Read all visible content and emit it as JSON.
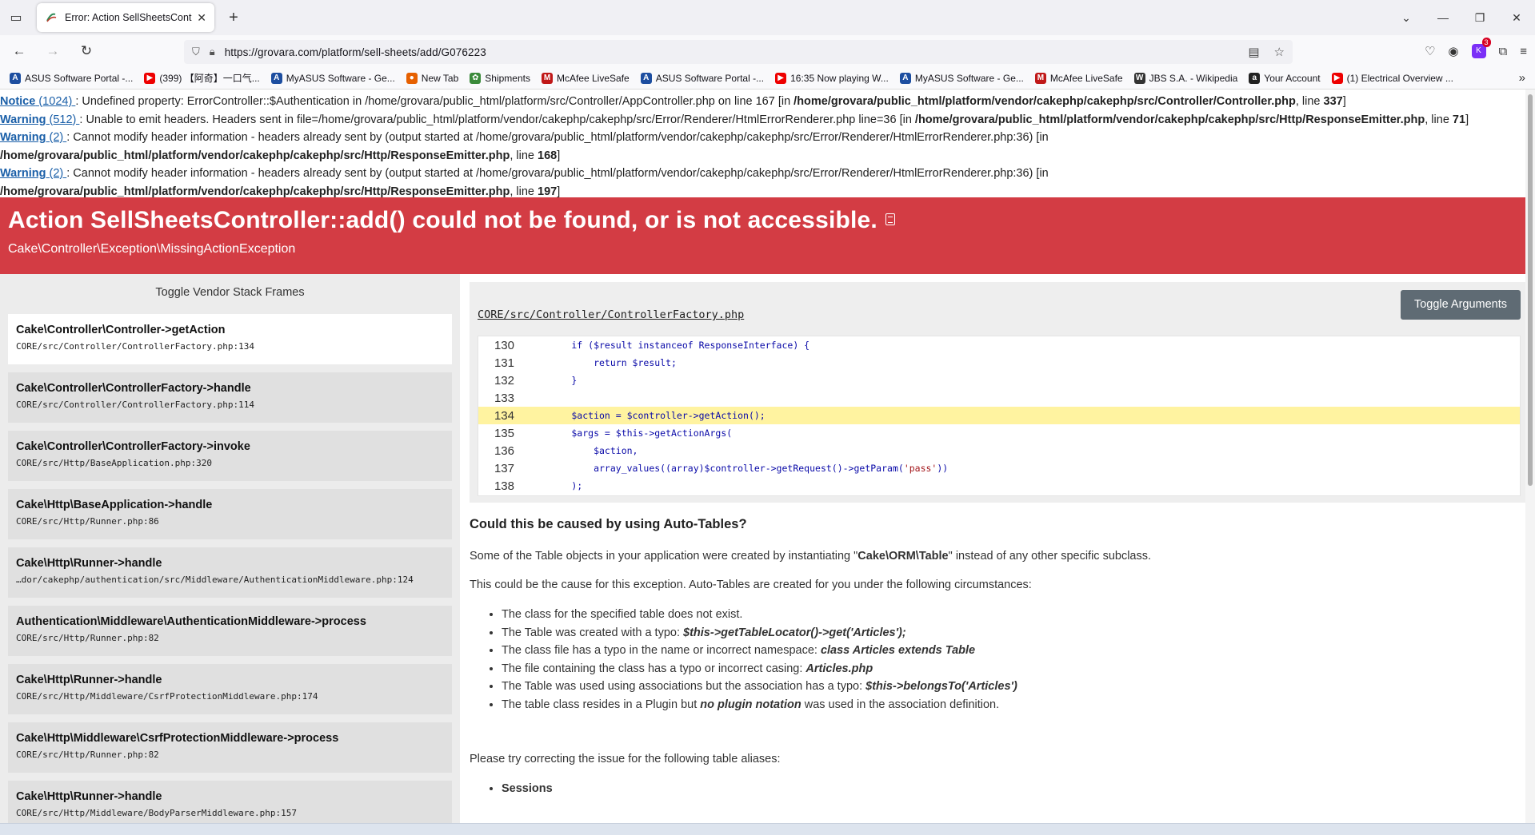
{
  "browser": {
    "tab_title": "Error: Action SellSheetsControll",
    "url": "https://grovara.com/platform/sell-sheets/add/G076223",
    "extension_count": "3",
    "bookmarks": [
      {
        "label": "ASUS Software Portal -...",
        "icon": "asus-icon",
        "color": "#1d4ea0"
      },
      {
        "label": "(399) 【阿奇】一口气...",
        "icon": "youtube-icon",
        "color": "#e00"
      },
      {
        "label": "MyASUS Software - Ge...",
        "icon": "asus-icon",
        "color": "#1d4ea0"
      },
      {
        "label": "New Tab",
        "icon": "firefox-icon",
        "color": "#e66000"
      },
      {
        "label": "Shipments",
        "icon": "gear-icon",
        "color": "#3a8a3a"
      },
      {
        "label": "McAfee LiveSafe",
        "icon": "mcafee-icon",
        "color": "#c01818"
      },
      {
        "label": "ASUS Software Portal -...",
        "icon": "asus-icon",
        "color": "#1d4ea0"
      },
      {
        "label": "16:35  Now playing  W...",
        "icon": "youtube-icon",
        "color": "#e00"
      },
      {
        "label": "MyASUS Software - Ge...",
        "icon": "asus-icon",
        "color": "#1d4ea0"
      },
      {
        "label": "McAfee LiveSafe",
        "icon": "mcafee-icon",
        "color": "#c01818"
      },
      {
        "label": "JBS S.A. - Wikipedia",
        "icon": "wikipedia-icon",
        "color": "#333"
      },
      {
        "label": "Your Account",
        "icon": "amazon-icon",
        "color": "#222"
      },
      {
        "label": "(1) Electrical Overview ...",
        "icon": "youtube-icon",
        "color": "#e00"
      }
    ]
  },
  "notices": [
    {
      "type": "Notice",
      "code": "(1024)",
      "text": ": Undefined property: ErrorController::$Authentication in /home/grovara/public_html/platform/src/Controller/AppController.php on line 167 [in ",
      "path": "/home/grovara/public_html/platform/vendor/cakephp/cakephp/src/Controller/Controller.php",
      "line_label": ", line ",
      "line": "337",
      "tail": "]"
    },
    {
      "type": "Warning",
      "code": "(512)",
      "text": ": Unable to emit headers. Headers sent in file=/home/grovara/public_html/platform/vendor/cakephp/cakephp/src/Error/Renderer/HtmlErrorRenderer.php line=36 [in ",
      "path": "/home/grovara/public_html/platform/vendor/cakephp/cakephp/src/Http/ResponseEmitter.php",
      "line_label": ", line ",
      "line": "71",
      "tail": "]"
    },
    {
      "type": "Warning",
      "code": "(2)",
      "text": ": Cannot modify header information - headers already sent by (output started at /home/grovara/public_html/platform/vendor/cakephp/cakephp/src/Error/Renderer/HtmlErrorRenderer.php:36) [in ",
      "path": "/home/grovara/public_html/platform/vendor/cakephp/cakephp/src/Http/ResponseEmitter.php",
      "line_label": ", line ",
      "line": "168",
      "tail": "]"
    },
    {
      "type": "Warning",
      "code": "(2)",
      "text": ": Cannot modify header information - headers already sent by (output started at /home/grovara/public_html/platform/vendor/cakephp/cakephp/src/Error/Renderer/HtmlErrorRenderer.php:36) [in ",
      "path": "/home/grovara/public_html/platform/vendor/cakephp/cakephp/src/Http/ResponseEmitter.php",
      "line_label": ", line ",
      "line": "197",
      "tail": "]"
    }
  ],
  "error": {
    "title": "Action SellSheetsController::add() could not be found, or is not accessible.",
    "exception": "Cake\\Controller\\Exception\\MissingActionException",
    "header_color": "#d33c44"
  },
  "stack": {
    "toggle_label": "Toggle Vendor Stack Frames",
    "frames": [
      {
        "name": "Cake\\Controller\\Controller->getAction",
        "location": "CORE/src/Controller/ControllerFactory.php:134",
        "active": true
      },
      {
        "name": "Cake\\Controller\\ControllerFactory->handle",
        "location": "CORE/src/Controller/ControllerFactory.php:114",
        "active": false
      },
      {
        "name": "Cake\\Controller\\ControllerFactory->invoke",
        "location": "CORE/src/Http/BaseApplication.php:320",
        "active": false
      },
      {
        "name": "Cake\\Http\\BaseApplication->handle",
        "location": "CORE/src/Http/Runner.php:86",
        "active": false
      },
      {
        "name": "Cake\\Http\\Runner->handle",
        "location": "…dor/cakephp/authentication/src/Middleware/AuthenticationMiddleware.php:124",
        "active": false
      },
      {
        "name": "Authentication\\Middleware\\AuthenticationMiddleware->process",
        "location": "CORE/src/Http/Runner.php:82",
        "active": false
      },
      {
        "name": "Cake\\Http\\Runner->handle",
        "location": "CORE/src/Http/Middleware/CsrfProtectionMiddleware.php:174",
        "active": false
      },
      {
        "name": "Cake\\Http\\Middleware\\CsrfProtectionMiddleware->process",
        "location": "CORE/src/Http/Runner.php:82",
        "active": false
      },
      {
        "name": "Cake\\Http\\Runner->handle",
        "location": "CORE/src/Http/Middleware/BodyParserMiddleware.php:157",
        "active": false
      }
    ]
  },
  "code": {
    "file": "CORE/src/Controller/ControllerFactory.php",
    "toggle_args_label": "Toggle Arguments",
    "highlight_line": "134",
    "lines": [
      {
        "n": "130",
        "text": "        if ($result instanceof ResponseInterface) {"
      },
      {
        "n": "131",
        "text": "            return $result;"
      },
      {
        "n": "132",
        "text": "        }"
      },
      {
        "n": "133",
        "text": ""
      },
      {
        "n": "134",
        "text": "        $action = $controller->getAction();"
      },
      {
        "n": "135",
        "text": "        $args = $this->getActionArgs("
      },
      {
        "n": "136",
        "text": "            $action,"
      },
      {
        "n": "137",
        "text": "            array_values((array)$controller->getRequest()->getParam(",
        "str": "'pass'",
        "after": "))"
      },
      {
        "n": "138",
        "text": "        );"
      }
    ]
  },
  "autotables": {
    "heading": "Could this be caused by using Auto-Tables?",
    "p1_pre": "Some of the Table objects in your application were created by instantiating \"",
    "p1_bold": "Cake\\ORM\\Table",
    "p1_post": "\" instead of any other specific subclass.",
    "p2": "This could be the cause for this exception. Auto-Tables are created for you under the following circumstances:",
    "items": [
      {
        "text": "The class for the specified table does not exist.",
        "em": ""
      },
      {
        "text": "The Table was created with a typo: ",
        "em": "$this->getTableLocator()->get('Articles');"
      },
      {
        "text": "The class file has a typo in the name or incorrect namespace: ",
        "em": "class Articles extends Table"
      },
      {
        "text": "The file containing the class has a typo or incorrect casing: ",
        "em": "Articles.php"
      },
      {
        "text": "The Table was used using associations but the association has a typo: ",
        "em": "$this->belongsTo('Articles')"
      },
      {
        "text": "The table class resides in a Plugin but ",
        "em": "no plugin notation",
        "after": " was used in the association definition."
      }
    ],
    "p3": "Please try correcting the issue for the following table aliases:",
    "aliases": [
      "Sessions"
    ]
  }
}
